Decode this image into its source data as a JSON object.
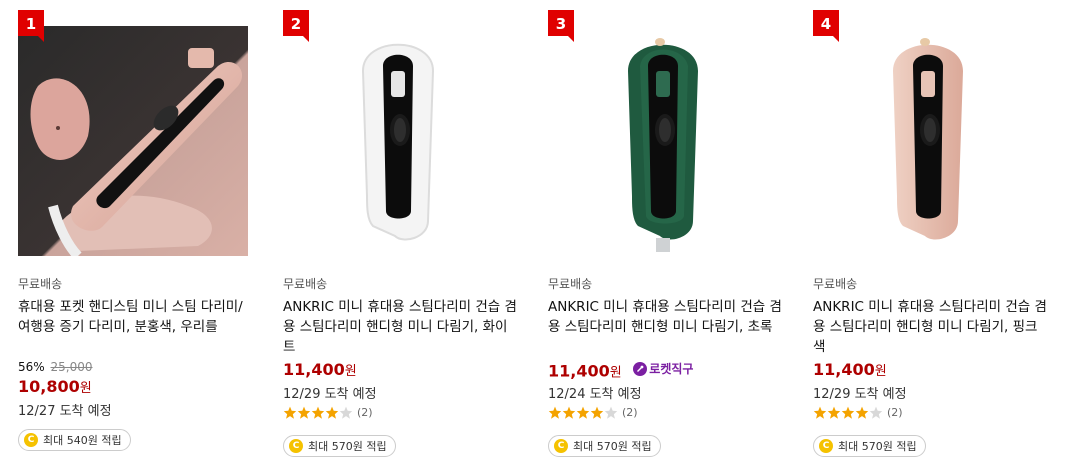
{
  "products": [
    {
      "rank": "1",
      "shipping": "무료배송",
      "title": "휴대용 포켓 핸디스팀 미니 스팀 다리미/여행용 증기 다리미, 분홍색, 우리를",
      "discount_rate": "56%",
      "original_price": "25,000",
      "price": "10,800",
      "won": "원",
      "delivery": "12/27 도착 예정",
      "cashback": "최대 540원 적립",
      "image": "pink-handheld-steamer-photo",
      "image_color": "#d8a9a0"
    },
    {
      "rank": "2",
      "shipping": "무료배송",
      "title": "ANKRIC 미니 휴대용 스팀다리미 건습 겸용 스팀다리미 핸디형 미니 다림기, 화이트",
      "price": "11,400",
      "won": "원",
      "delivery": "12/29 도착 예정",
      "rating": 4,
      "review_count": "(2)",
      "cashback": "최대 570원 적립",
      "image": "white-handheld-steamer",
      "image_color": "#f4f4f4"
    },
    {
      "rank": "3",
      "shipping": "무료배송",
      "title": "ANKRIC 미니 휴대용 스팀다리미 건습 겸용 스팀다리미 핸디형 미니 다림기, 초록",
      "price": "11,400",
      "won": "원",
      "rocket_label": "로켓직구",
      "delivery": "12/24 도착 예정",
      "rating": 4,
      "review_count": "(2)",
      "cashback": "최대 570원 적립",
      "image": "green-handheld-steamer",
      "image_color": "#1f5a3f"
    },
    {
      "rank": "4",
      "shipping": "무료배송",
      "title": "ANKRIC 미니 휴대용 스팀다리미 건습 겸용 스팀다리미 핸디형 미니 다림기, 핑크색",
      "price": "11,400",
      "won": "원",
      "delivery": "12/29 도착 예정",
      "rating": 4,
      "review_count": "(2)",
      "cashback": "최대 570원 적립",
      "image": "pink-handheld-steamer",
      "image_color": "#e8c2b4"
    }
  ],
  "colors": {
    "rank_badge": "#e00000",
    "price": "#ae0000",
    "star": "#f4a300",
    "star_empty": "#d8d8d8",
    "rocket": "#7b1fa2",
    "coin": "#f5c200"
  },
  "icons": {
    "coin": "C"
  }
}
